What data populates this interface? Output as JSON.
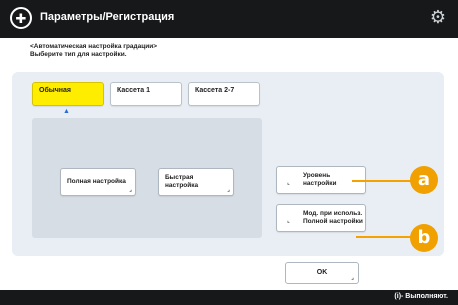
{
  "header": {
    "app_icon": "settings-register-icon",
    "title": "Параметры/Регистрация",
    "gear_icon": "gear-icon"
  },
  "instructions": {
    "line1": "<Автоматическая настройка градации>",
    "line2": "Выберите тип для настройки."
  },
  "tabs": [
    {
      "label": "Обычная",
      "selected": true
    },
    {
      "label": "Кассета 1",
      "selected": false
    },
    {
      "label": "Кассета 2-7",
      "selected": false
    }
  ],
  "main_buttons": {
    "full": "Полная настройка",
    "quick_line1": "Быстрая",
    "quick_line2": "настройка"
  },
  "side_buttons": {
    "level_line1": "Уровень",
    "level_line2": "настройки",
    "multi_line1": "Мод. при использ.",
    "multi_line2": "Полной настройки"
  },
  "callouts": {
    "a": "a",
    "b": "b",
    "color": "#f0a000"
  },
  "footer": {
    "ok": "OK"
  },
  "status_bar": {
    "text": "(i)- Выполняют."
  },
  "colors": {
    "selected_tab": "#ffed00",
    "titlebar": "#17181a",
    "panel": "#e8eef4"
  }
}
